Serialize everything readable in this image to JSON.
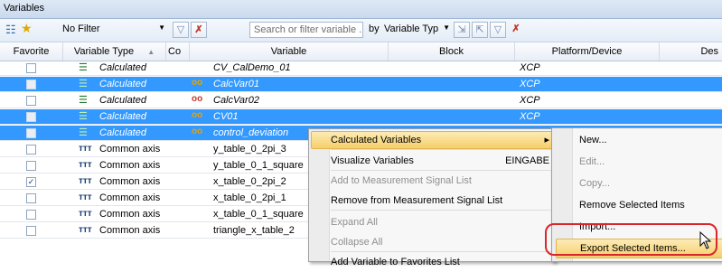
{
  "window": {
    "title": "Variables"
  },
  "toolbar": {
    "filter_value": "No Filter",
    "search_placeholder": "Search or filter variable ...",
    "by_label": "by",
    "variable_type_value": "Variable Typ"
  },
  "columns": {
    "favorite": "Favorite",
    "variable_type": "Variable Type",
    "comment": "Co",
    "variable": "Variable",
    "block": "Block",
    "platform": "Platform/Device",
    "description": "Des"
  },
  "rows": [
    {
      "type": "Calculated",
      "variable": "CV_CalDemo_01",
      "platform": "XCP",
      "checked": false,
      "selected": false,
      "link": ""
    },
    {
      "type": "Calculated",
      "variable": "CalcVar01",
      "platform": "XCP",
      "checked": false,
      "selected": true,
      "link": "oo"
    },
    {
      "type": "Calculated",
      "variable": "CalcVar02",
      "platform": "XCP",
      "checked": false,
      "selected": false,
      "link": "oo"
    },
    {
      "type": "Calculated",
      "variable": "CV01",
      "platform": "XCP",
      "checked": false,
      "selected": true,
      "link": "oo"
    },
    {
      "type": "Calculated",
      "variable": "control_deviation",
      "platform": "",
      "checked": false,
      "selected": true,
      "link": "oo"
    },
    {
      "type": "Common axis",
      "variable": "y_table_0_2pi_3",
      "platform": "",
      "checked": false,
      "selected": false,
      "link": ""
    },
    {
      "type": "Common axis",
      "variable": "y_table_0_1_square",
      "platform": "",
      "checked": false,
      "selected": false,
      "link": ""
    },
    {
      "type": "Common axis",
      "variable": "x_table_0_2pi_2",
      "platform": "",
      "checked": true,
      "selected": false,
      "link": ""
    },
    {
      "type": "Common axis",
      "variable": "x_table_0_2pi_1",
      "platform": "",
      "checked": false,
      "selected": false,
      "link": ""
    },
    {
      "type": "Common axis",
      "variable": "x_table_0_1_square",
      "platform": "",
      "checked": false,
      "selected": false,
      "link": ""
    },
    {
      "type": "Common axis",
      "variable": "triangle_x_table_2",
      "platform": "",
      "checked": false,
      "selected": false,
      "link": ""
    }
  ],
  "context_menu": {
    "items": [
      {
        "label": "Calculated Variables",
        "shortcut": "",
        "disabled": false,
        "highlighted": true,
        "submenu": true
      },
      {
        "label": "Visualize Variables",
        "shortcut": "EINGABE",
        "disabled": false
      },
      {
        "label": "Add to Measurement Signal List",
        "shortcut": "",
        "disabled": true
      },
      {
        "label": "Remove from Measurement Signal List",
        "shortcut": "",
        "disabled": false
      },
      {
        "label": "Expand All",
        "shortcut": "",
        "disabled": true
      },
      {
        "label": "Collapse All",
        "shortcut": "",
        "disabled": true
      },
      {
        "label": "Add Variable to Favorites List",
        "shortcut": "",
        "disabled": false
      }
    ]
  },
  "submenu": {
    "items": [
      {
        "label": "New...",
        "disabled": false
      },
      {
        "label": "Edit...",
        "disabled": true
      },
      {
        "label": "Copy...",
        "disabled": true
      },
      {
        "label": "Remove Selected Items",
        "disabled": false
      },
      {
        "label": "Import...",
        "disabled": false
      },
      {
        "label": "Export Selected Items...",
        "disabled": false,
        "highlighted": true
      }
    ]
  },
  "colors": {
    "selection": "#3399ff",
    "highlight_ring": "#d9262c"
  }
}
